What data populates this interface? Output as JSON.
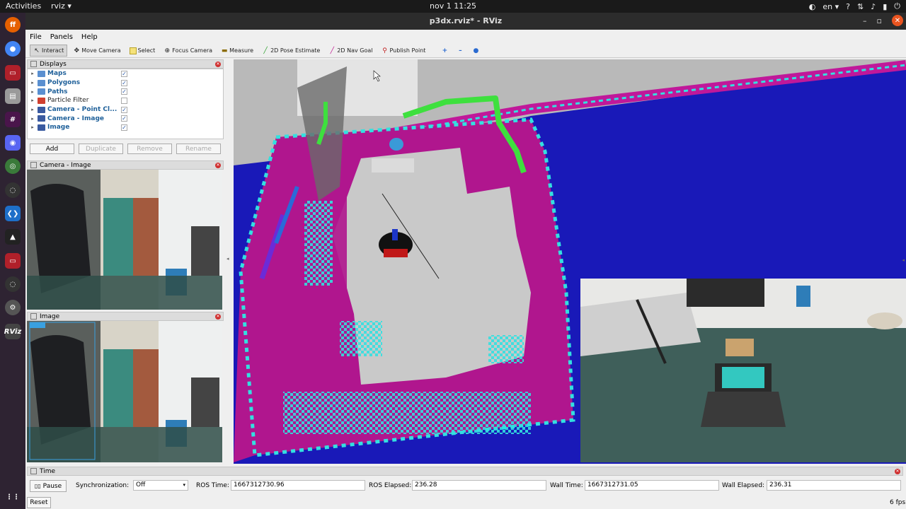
{
  "topbar": {
    "activities": "Activities",
    "app": "rviz ▾",
    "clock": "nov 1  11:25",
    "lang": "en ▾"
  },
  "window": {
    "title": "p3dx.rviz* - RViz"
  },
  "menu": [
    "File",
    "Panels",
    "Help"
  ],
  "toolbar": {
    "interact": "Interact",
    "move_camera": "Move Camera",
    "select": "Select",
    "focus_camera": "Focus Camera",
    "measure": "Measure",
    "pose_estimate": "2D Pose Estimate",
    "nav_goal": "2D Nav Goal",
    "publish_point": "Publish Point"
  },
  "displays": {
    "title": "Displays",
    "items": [
      {
        "label": "Maps",
        "checked": "✓"
      },
      {
        "label": "Polygons",
        "checked": "✓"
      },
      {
        "label": "Paths",
        "checked": "✓"
      },
      {
        "label": "Particle Filter",
        "checked": ""
      },
      {
        "label": "Camera - Point Cl...",
        "checked": "✓"
      },
      {
        "label": "Camera - Image",
        "checked": "✓"
      },
      {
        "label": "Image",
        "checked": "✓"
      }
    ],
    "add": "Add",
    "duplicate": "Duplicate",
    "remove": "Remove",
    "rename": "Rename"
  },
  "camera_panel": {
    "title": "Camera - Image"
  },
  "image_panel": {
    "title": "Image"
  },
  "time": {
    "title": "Time",
    "pause": "Pause",
    "sync_label": "Synchronization:",
    "sync_value": "Off",
    "ros_time_label": "ROS Time:",
    "ros_time": "1667312730.96",
    "ros_elapsed_label": "ROS Elapsed:",
    "ros_elapsed": "236.28",
    "wall_time_label": "Wall Time:",
    "wall_time": "1667312731.05",
    "wall_elapsed_label": "Wall Elapsed:",
    "wall_elapsed": "236.31",
    "reset": "Reset",
    "fps": "6 fps"
  },
  "colors": {
    "map_blue": "#1919b8",
    "costmap_magenta": "#c0189a",
    "costmap_cyan": "#33e0e0",
    "free_grey": "#c9c9c9",
    "path_green": "#3ee03e",
    "accent": "#e95420"
  }
}
